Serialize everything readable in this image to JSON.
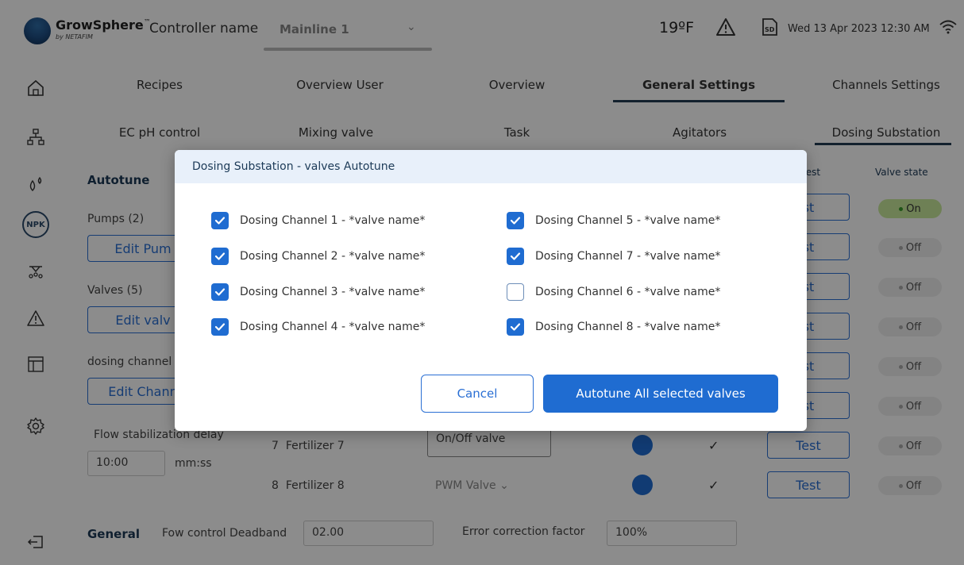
{
  "header": {
    "logo_text": "GrowSphere",
    "logo_tm": "™",
    "logo_sub": "by NETAFIM",
    "controller_label": "Controller name",
    "controller_value": "Mainline 1",
    "temperature": "19ºF",
    "sd_label": "SD",
    "datetime": "Wed 13 Apr 2023  12:30 AM"
  },
  "sidebar": {
    "npk_label": "NPK"
  },
  "tabs_primary": [
    {
      "label": "Recipes"
    },
    {
      "label": "Overview User"
    },
    {
      "label": "Overview"
    },
    {
      "label": "General Settings"
    },
    {
      "label": "Channels Settings"
    }
  ],
  "tabs_secondary": [
    {
      "label": "EC pH control"
    },
    {
      "label": "Mixing valve"
    },
    {
      "label": "Task"
    },
    {
      "label": "Agitators"
    },
    {
      "label": "Dosing Substation"
    }
  ],
  "left_panel": {
    "autotune_title": "Autotune",
    "pumps_label": "Pumps (2)",
    "edit_pumps": "Edit Pum",
    "valves_label": "Valves (5)",
    "edit_valves": "Edit valv",
    "channels_label": "dosing channel",
    "edit_channels": "Edit Chann",
    "flow_label": "Flow stabilization delay",
    "flow_value": "10:00",
    "flow_unit": "mm:ss"
  },
  "table": {
    "col_valve_test": "test",
    "col_valve_state": "Valve state",
    "test_label": "Test",
    "test_partial": "st",
    "states": [
      "On",
      "Off",
      "Off",
      "Off",
      "Off",
      "Off",
      "Off",
      "Off"
    ],
    "rows": [
      {
        "num": "7",
        "name": "Fertilizer 7",
        "valve": "On/Off valve",
        "check": "✓"
      },
      {
        "num": "8",
        "name": "Fertilizer 8",
        "valve": "PWM Valve",
        "check": "✓"
      }
    ]
  },
  "general": {
    "label": "General",
    "deadband_label": "Fow control Deadband",
    "deadband_value": "02.00",
    "error_label": "Error correction factor",
    "error_value": "100%"
  },
  "modal": {
    "title": "Dosing Substation - valves Autotune",
    "left_options": [
      {
        "label": "Dosing Channel 1 - *valve name*",
        "checked": true
      },
      {
        "label": "Dosing Channel 2 - *valve name*",
        "checked": true
      },
      {
        "label": "Dosing Channel 3 - *valve name*",
        "checked": true
      },
      {
        "label": "Dosing Channel 4 - *valve name*",
        "checked": true
      }
    ],
    "right_options": [
      {
        "label": "Dosing Channel 5 - *valve name*",
        "checked": true
      },
      {
        "label": "Dosing Channel 7 - *valve name*",
        "checked": true
      },
      {
        "label": "Dosing Channel 6 - *valve name*",
        "checked": false
      },
      {
        "label": "Dosing Channel 8 - *valve name*",
        "checked": true
      }
    ],
    "cancel_label": "Cancel",
    "primary_label": "Autotune All selected valves"
  },
  "colors": {
    "primary": "#1f6cd1",
    "on_state": "#c9ea9c"
  }
}
